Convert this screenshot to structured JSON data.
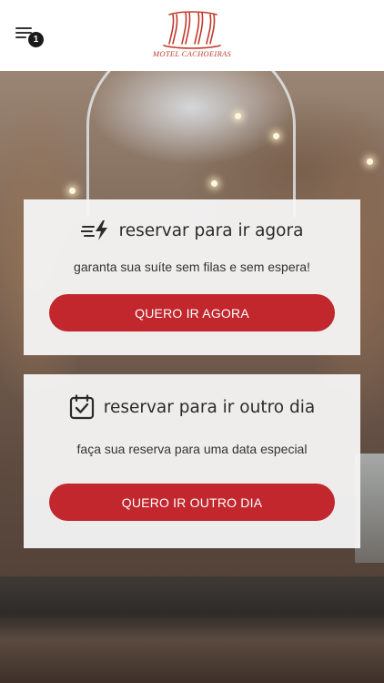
{
  "header": {
    "menu_icon": "hamburger-menu-icon",
    "badge_count": "1",
    "logo_text": "MOTEL CACHOEIRAS",
    "brand_color": "#c0392b"
  },
  "cards": [
    {
      "icon": "lightning-speed-icon",
      "title": "reservar para ir agora",
      "subtitle": "garanta sua suíte sem filas e sem espera!",
      "button_label": "QUERO IR AGORA"
    },
    {
      "icon": "calendar-check-icon",
      "title": "reservar para ir outro dia",
      "subtitle": "faça sua reserva para uma data especial",
      "button_label": "QUERO IR OUTRO DIA"
    }
  ],
  "colors": {
    "accent": "#c1272d",
    "card_bg": "#f5f5f5",
    "text": "#2b2b2b"
  }
}
